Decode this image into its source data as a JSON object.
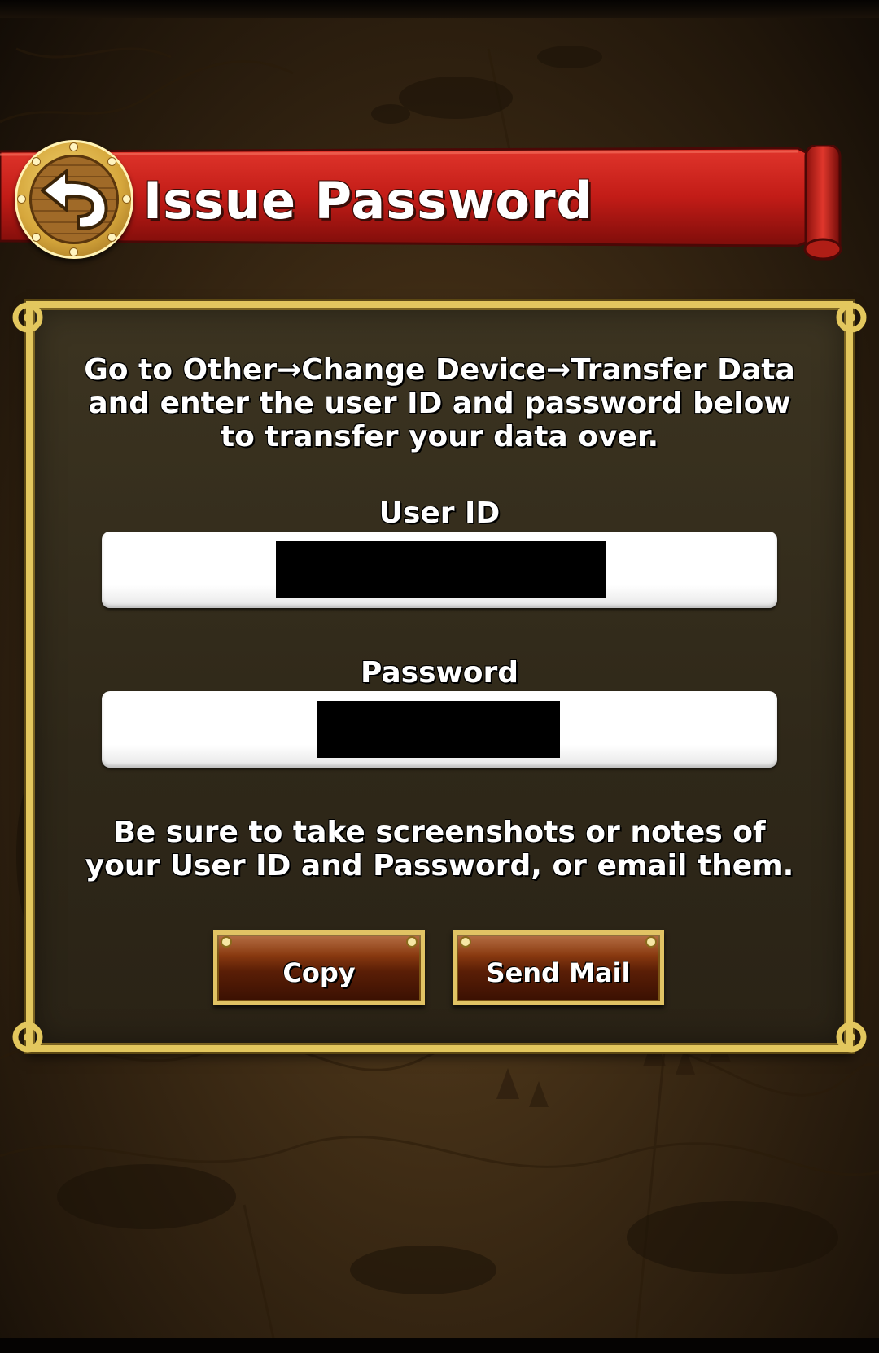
{
  "header": {
    "title": "Issue Password",
    "back_icon": "back-arrow-icon"
  },
  "dialog": {
    "instructions": [
      "Go to Other→Change Device→Transfer Data",
      "and enter the user ID and password below",
      "to transfer your data over."
    ],
    "user_id": {
      "label": "User ID",
      "value": ""
    },
    "password": {
      "label": "Password",
      "value": ""
    },
    "note": [
      "Be sure to take screenshots or notes of",
      "your User ID and Password, or email them."
    ],
    "buttons": {
      "copy_label": "Copy",
      "send_mail_label": "Send Mail"
    }
  },
  "colors": {
    "banner_red": "#c81e1a",
    "frame_gold": "#e3c75e",
    "panel_dark": "#2f2819",
    "button_brown": "#5a1e06"
  }
}
